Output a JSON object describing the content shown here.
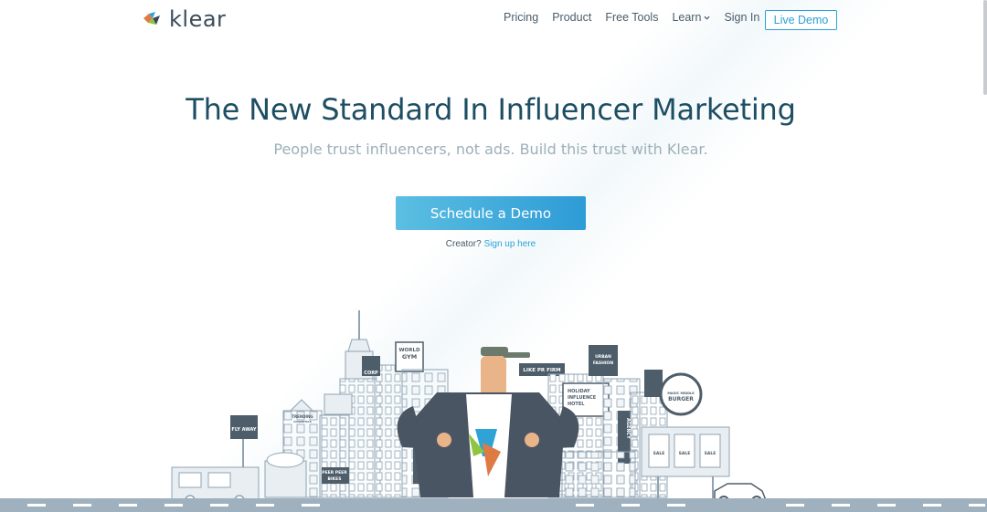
{
  "header": {
    "logo_text": "klear",
    "nav": {
      "pricing": "Pricing",
      "product": "Product",
      "free_tools": "Free Tools",
      "learn": "Learn",
      "sign_in": "Sign In"
    },
    "live_demo": "Live Demo"
  },
  "hero": {
    "title": "The New Standard In Influencer Marketing",
    "subtitle": "People trust influencers, not ads. Build this trust with Klear.",
    "cta": "Schedule a Demo",
    "creator_prefix": "Creator?",
    "creator_link": "Sign up here"
  },
  "illustration": {
    "signs": {
      "corp": "CORP",
      "world_gym": "WORLD",
      "gym": "GYM",
      "like_pr": "LIKE PR FIRM",
      "urban": "URBAN",
      "fashion": "FASHION",
      "holiday": "HOLIDAY",
      "influence": "INFLUENCE",
      "hotel": "HOTEL",
      "agency": "AGENCY",
      "burger_top": "MAGIC MIDDLE",
      "burger": "BURGER",
      "fly_away": "FLY AWAY",
      "trending": "TRENDING",
      "cosmetics": "COSMETICS",
      "peer": "PEER PEER",
      "bikes": "BIKES",
      "sale": "SALE"
    }
  },
  "colors": {
    "title": "#1e4e63",
    "accent": "#2ba1d3",
    "cta_start": "#5cbfe2",
    "cta_end": "#2d9bd6",
    "subtitle": "#9eafb9",
    "nav": "#4a5d6b",
    "road": "#9fb1bf"
  },
  "icons": {
    "logo": "klear-logo-icon",
    "learn_chevron": "chevron-down-icon"
  }
}
